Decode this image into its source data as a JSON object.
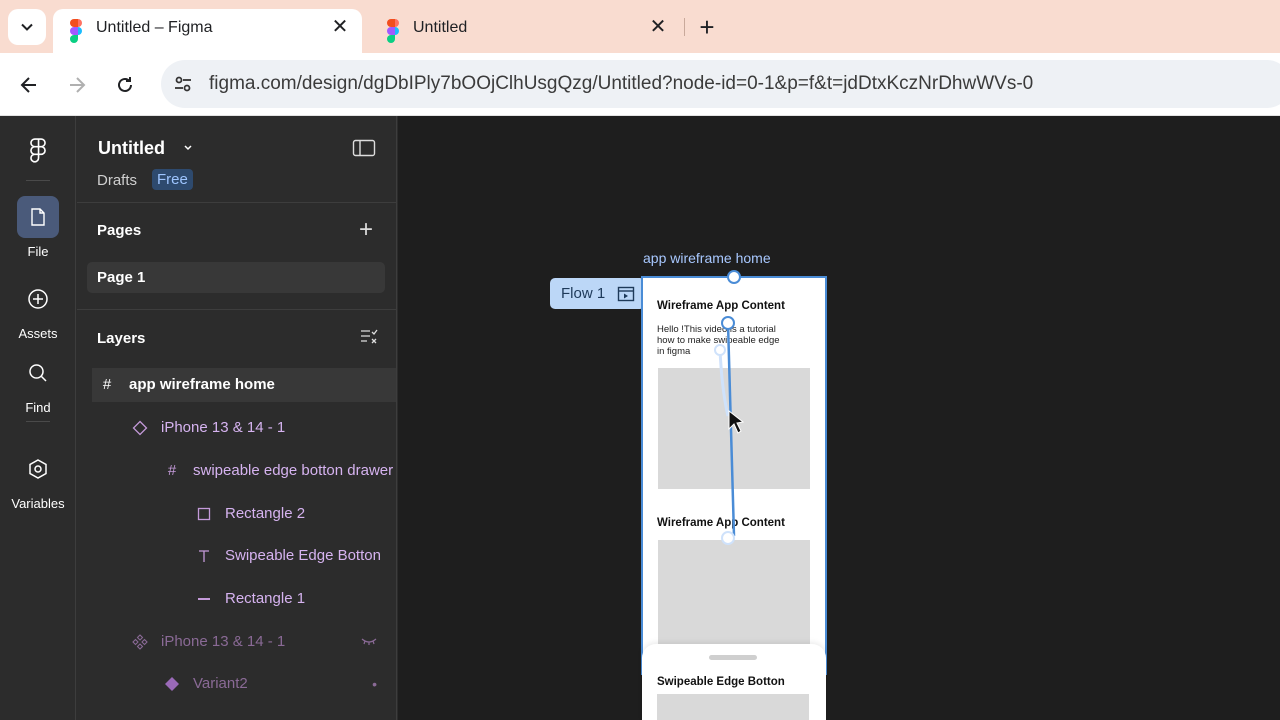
{
  "browser": {
    "tabs": [
      {
        "title": "Untitled – Figma",
        "active": true
      },
      {
        "title": "Untitled",
        "active": false
      }
    ],
    "url": "figma.com/design/dgDbIPly7bOOjClhUsgQzg/Untitled?node-id=0-1&p=f&t=jdDtxKczNrDhwWVs-0"
  },
  "rail": {
    "items": [
      {
        "label": "File",
        "icon": "file-icon",
        "selected": true
      },
      {
        "label": "Assets",
        "icon": "plus-circle-icon"
      },
      {
        "label": "Find",
        "icon": "search-icon"
      },
      {
        "label": "Variables",
        "icon": "hexagon-icon"
      }
    ]
  },
  "panel": {
    "file_title": "Untitled",
    "drafts": "Drafts",
    "plan_badge": "Free",
    "pages_header": "Pages",
    "pages": [
      "Page 1"
    ],
    "layers_header": "Layers",
    "layers": [
      {
        "name": "app wireframe home",
        "icon": "frame-hash-icon",
        "depth": 0,
        "selected": true
      },
      {
        "name": "iPhone 13 & 14 - 1",
        "icon": "instance-diamond-icon",
        "depth": 1
      },
      {
        "name": "swipeable edge botton drawer",
        "icon": "frame-hash-icon",
        "depth": 2
      },
      {
        "name": "Rectangle 2",
        "icon": "rectangle-icon",
        "depth": 3
      },
      {
        "name": "Swipeable Edge Botton",
        "icon": "text-icon",
        "depth": 3
      },
      {
        "name": "Rectangle 1",
        "icon": "line-icon",
        "depth": 3
      },
      {
        "name": "iPhone 13 & 14 - 1",
        "icon": "component-set-icon",
        "depth": 1,
        "dimmed": true
      },
      {
        "name": "Variant2",
        "icon": "component-diamond-icon",
        "depth": 2,
        "dimmed": true
      }
    ]
  },
  "canvas": {
    "frame_label": "app wireframe home",
    "flow_label": "Flow 1",
    "heading1": "Wireframe App Content",
    "paragraph": "Hello !This video is a tutorial how to make swipeable edge in figma",
    "heading2": "Wireframe App Content",
    "drawer_title": "Swipeable Edge Botton"
  },
  "colors": {
    "accent": "#4a8cd6",
    "layer_purple": "#d6b3f0",
    "canvas_bg": "#1e1e1e",
    "panel_bg": "#2c2c2c"
  }
}
